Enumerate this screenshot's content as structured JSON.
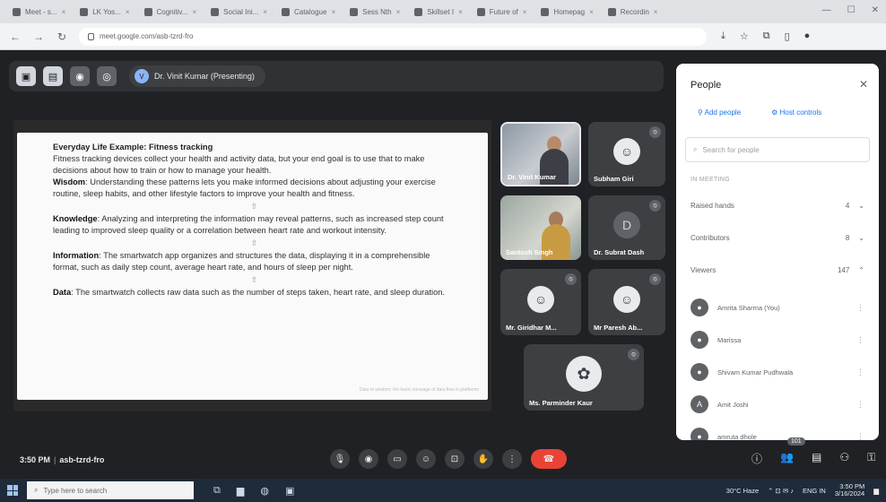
{
  "browser": {
    "tabs": [
      {
        "label": "Meet - s..."
      },
      {
        "label": "LK Yos..."
      },
      {
        "label": "Cognitiv..."
      },
      {
        "label": "Social Ini..."
      },
      {
        "label": "Catalogue"
      },
      {
        "label": "Sess Nth"
      },
      {
        "label": "Skillset I"
      },
      {
        "label": "Future of"
      },
      {
        "label": "Homepag"
      },
      {
        "label": "Recordin"
      }
    ],
    "url": "meet.google.com/asb-tzrd-fro"
  },
  "meet": {
    "presenting_label": "Dr. Vinit Kumar (Presenting)",
    "time": "3:50 PM",
    "meeting_code": "asb-tzrd-fro",
    "participant_count": "101",
    "tiles": [
      {
        "name": "Dr. Vinit Kumar",
        "type": "video"
      },
      {
        "name": "Subham Giri",
        "type": "avatar"
      },
      {
        "name": "Santosh Singh",
        "type": "video"
      },
      {
        "name": "Dr. Subrat Dash",
        "type": "avatar"
      },
      {
        "name": "Mr. Giridhar M...",
        "type": "avatar"
      },
      {
        "name": "Mr Paresh Ab...",
        "type": "avatar"
      },
      {
        "name": "Ms. Parminder Kaur",
        "type": "avatar"
      }
    ]
  },
  "slide": {
    "heading": "Everyday Life Example: Fitness tracking",
    "intro": "Fitness tracking devices collect your health and activity data, but your end goal is to use that to make decisions about how to train or how to manage your health.",
    "wisdom_term": "Wisdom",
    "wisdom_text": ": Understanding these patterns lets you make informed decisions about adjusting your exercise routine, sleep habits, and other lifestyle factors to improve your health and fitness.",
    "knowledge_term": "Knowledge",
    "knowledge_text": ": Analyzing and interpreting the information may reveal patterns, such as increased step count leading to improved sleep quality or a correlation between heart rate and workout intensity.",
    "information_term": "Information",
    "information_text": ": The smartwatch app organizes and structures the data, displaying it in a comprehensible format, such as daily step count, average heart rate, and hours of sleep per night.",
    "data_term": "Data",
    "data_text": ": The smartwatch collects raw data such as the number of steps taken, heart rate, and sleep duration.",
    "arrow": "⇧",
    "footnote": "Data to wisdom: the basic message of data flow in platforms"
  },
  "people_panel": {
    "title": "People",
    "add_people": "Add people",
    "host_controls": "Host controls",
    "search_placeholder": "Search for people",
    "section_label": "IN MEETING",
    "groups": [
      {
        "label": "Raised hands",
        "count": "4"
      },
      {
        "label": "Contributors",
        "count": "8"
      },
      {
        "label": "Viewers",
        "count": "147"
      }
    ],
    "participants": [
      {
        "name": "Amrita Sharma (You)"
      },
      {
        "name": "Marissa"
      },
      {
        "name": "Shivam Kumar Pudhwala"
      },
      {
        "name": "Amit Joshi",
        "initial": "A"
      },
      {
        "name": "amruta dhole"
      }
    ]
  },
  "taskbar": {
    "search_placeholder": "Type here to search",
    "weather": "30°C Haze",
    "lang": "ENG IN",
    "clock_time": "3:50 PM",
    "clock_date": "3/16/2024"
  }
}
